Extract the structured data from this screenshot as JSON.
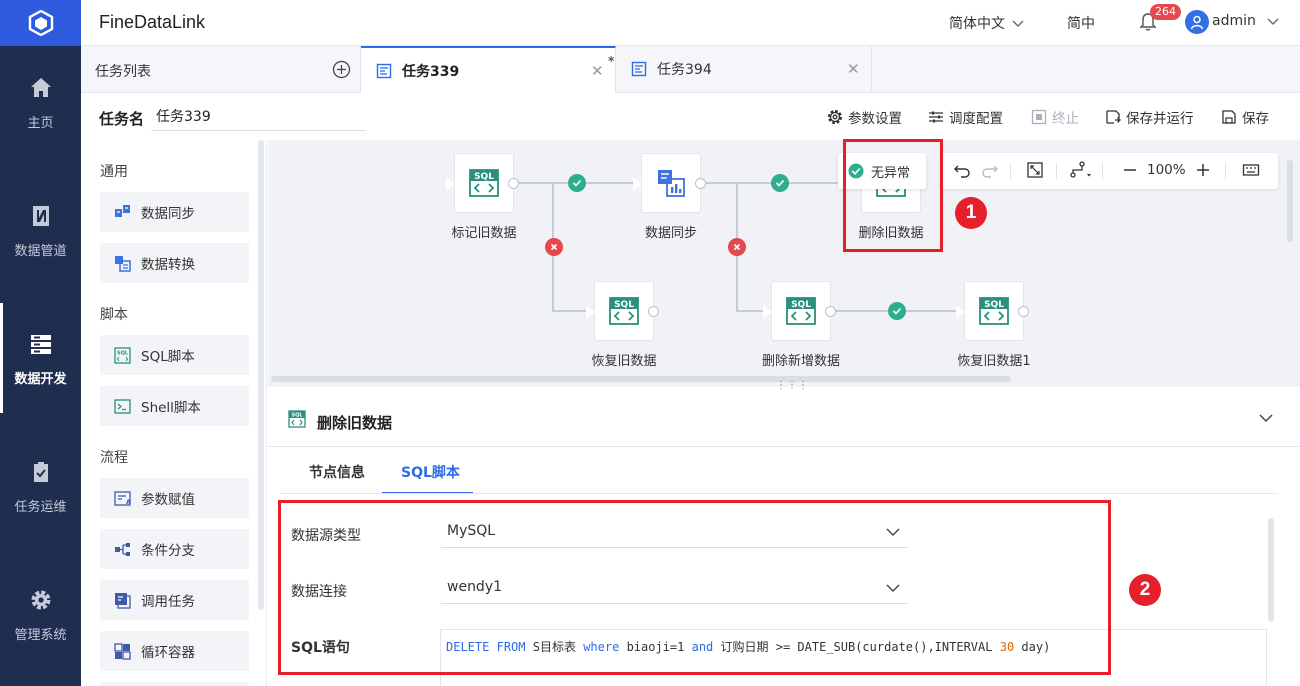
{
  "app": {
    "brand": "FineDataLink",
    "language": "简体中文",
    "simplified": "简中",
    "notification_count": "264",
    "user": "admin"
  },
  "leftnav": {
    "items": [
      {
        "label": "主页",
        "icon": "home-icon"
      },
      {
        "label": "数据管道",
        "icon": "pipeline-icon"
      },
      {
        "label": "数据开发",
        "icon": "dev-icon",
        "active": true
      },
      {
        "label": "任务运维",
        "icon": "clipboard-icon"
      },
      {
        "label": "管理系统",
        "icon": "gear-icon"
      }
    ]
  },
  "tabs": {
    "task_list": "任务列表",
    "open": [
      {
        "label": "任务339",
        "active": true,
        "modified": true
      },
      {
        "label": "任务394",
        "active": false
      }
    ]
  },
  "task": {
    "name_label": "任务名",
    "name_value": "任务339"
  },
  "toolbar": {
    "params": "参数设置",
    "schedule": "调度配置",
    "stop": "终止",
    "save_run": "保存并运行",
    "save": "保存"
  },
  "palette": {
    "groups": [
      {
        "title": "通用",
        "items": [
          "数据同步",
          "数据转换"
        ]
      },
      {
        "title": "脚本",
        "items": [
          "SQL脚本",
          "Shell脚本"
        ]
      },
      {
        "title": "流程",
        "items": [
          "参数赋值",
          "条件分支",
          "调用任务",
          "循环容器"
        ]
      }
    ]
  },
  "canvas": {
    "nodes": [
      {
        "label": "标记旧数据"
      },
      {
        "label": "数据同步"
      },
      {
        "label": "删除旧数据"
      },
      {
        "label": "恢复旧数据"
      },
      {
        "label": "删除新增数据"
      },
      {
        "label": "恢复旧数据1"
      }
    ],
    "status_pill": "无异常",
    "zoom": "100%"
  },
  "panel": {
    "title": "删除旧数据",
    "tabs": [
      "节点信息",
      "SQL脚本"
    ],
    "active_tab": "SQL脚本",
    "fields": {
      "source_type_label": "数据源类型",
      "source_type_value": "MySQL",
      "connection_label": "数据连接",
      "connection_value": "wendy1",
      "sql_label": "SQL语句"
    },
    "sql": {
      "kw_delete": "DELETE",
      "kw_from": "FROM",
      "table": "S目标表",
      "kw_where": "where",
      "cond1": "biaoji=1",
      "kw_and": "and",
      "cond2": "订购日期 >= DATE_SUB(curdate(),INTERVAL",
      "num": "30",
      "tail": "day)"
    }
  },
  "annotations": {
    "marker1": "1",
    "marker2": "2",
    "color": "#e5202a"
  },
  "colors": {
    "primary": "#2e6be6",
    "nav_bg": "#1f2d4f",
    "logo_bg": "#2e5bde",
    "success": "#2fae8f",
    "failure": "#e5484d",
    "node_teal": "#2a8f7e"
  }
}
